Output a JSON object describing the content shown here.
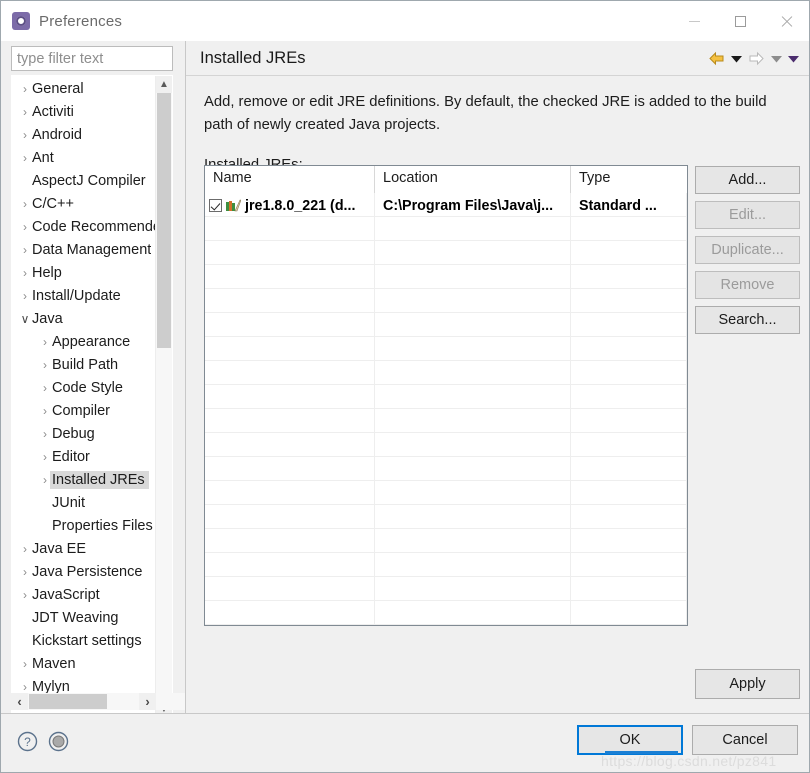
{
  "window": {
    "title": "Preferences",
    "icon": "gear-icon",
    "controls": {
      "minimize": "—",
      "maximize": "□",
      "close": "✕"
    }
  },
  "sidebar": {
    "filter": {
      "placeholder": "type filter text",
      "value": ""
    },
    "items": [
      {
        "label": "General",
        "level": 1,
        "expandable": true,
        "expanded": false,
        "selected": false
      },
      {
        "label": "Activiti",
        "level": 1,
        "expandable": true,
        "expanded": false,
        "selected": false
      },
      {
        "label": "Android",
        "level": 1,
        "expandable": true,
        "expanded": false,
        "selected": false
      },
      {
        "label": "Ant",
        "level": 1,
        "expandable": true,
        "expanded": false,
        "selected": false
      },
      {
        "label": "AspectJ Compiler",
        "level": 1,
        "expandable": false,
        "expanded": false,
        "selected": false
      },
      {
        "label": "C/C++",
        "level": 1,
        "expandable": true,
        "expanded": false,
        "selected": false
      },
      {
        "label": "Code Recommenders",
        "level": 1,
        "expandable": true,
        "expanded": false,
        "selected": false
      },
      {
        "label": "Data Management",
        "level": 1,
        "expandable": true,
        "expanded": false,
        "selected": false
      },
      {
        "label": "Help",
        "level": 1,
        "expandable": true,
        "expanded": false,
        "selected": false
      },
      {
        "label": "Install/Update",
        "level": 1,
        "expandable": true,
        "expanded": false,
        "selected": false
      },
      {
        "label": "Java",
        "level": 1,
        "expandable": true,
        "expanded": true,
        "selected": false
      },
      {
        "label": "Appearance",
        "level": 2,
        "expandable": true,
        "expanded": false,
        "selected": false
      },
      {
        "label": "Build Path",
        "level": 2,
        "expandable": true,
        "expanded": false,
        "selected": false
      },
      {
        "label": "Code Style",
        "level": 2,
        "expandable": true,
        "expanded": false,
        "selected": false
      },
      {
        "label": "Compiler",
        "level": 2,
        "expandable": true,
        "expanded": false,
        "selected": false
      },
      {
        "label": "Debug",
        "level": 2,
        "expandable": true,
        "expanded": false,
        "selected": false
      },
      {
        "label": "Editor",
        "level": 2,
        "expandable": true,
        "expanded": false,
        "selected": false
      },
      {
        "label": "Installed JREs",
        "level": 2,
        "expandable": true,
        "expanded": false,
        "selected": true
      },
      {
        "label": "JUnit",
        "level": 2,
        "expandable": false,
        "expanded": false,
        "selected": false
      },
      {
        "label": "Properties Files",
        "level": 2,
        "expandable": false,
        "expanded": false,
        "selected": false
      },
      {
        "label": "Java EE",
        "level": 1,
        "expandable": true,
        "expanded": false,
        "selected": false
      },
      {
        "label": "Java Persistence",
        "level": 1,
        "expandable": true,
        "expanded": false,
        "selected": false
      },
      {
        "label": "JavaScript",
        "level": 1,
        "expandable": true,
        "expanded": false,
        "selected": false
      },
      {
        "label": "JDT Weaving",
        "level": 1,
        "expandable": false,
        "expanded": false,
        "selected": false
      },
      {
        "label": "Kickstart settings",
        "level": 1,
        "expandable": false,
        "expanded": false,
        "selected": false
      },
      {
        "label": "Maven",
        "level": 1,
        "expandable": true,
        "expanded": false,
        "selected": false
      },
      {
        "label": "Mylyn",
        "level": 1,
        "expandable": true,
        "expanded": false,
        "selected": false
      }
    ]
  },
  "page": {
    "title": "Installed JREs",
    "description": "Add, remove or edit JRE definitions. By default, the checked JRE is added to the build path of newly created Java projects.",
    "list_label": "Installed JREs:",
    "nav": {
      "back": "back-arrow-icon",
      "back_menu": "back-dropdown-icon",
      "forward": "forward-arrow-icon",
      "forward_menu": "forward-dropdown-icon",
      "menu": "view-menu-icon"
    }
  },
  "table": {
    "columns": [
      "Name",
      "Location",
      "Type"
    ],
    "rows": [
      {
        "checked": true,
        "name": "jre1.8.0_221 (d...",
        "location": "C:\\Program Files\\Java\\j...",
        "type": "Standard ..."
      }
    ],
    "empty_row_count": 17
  },
  "side_buttons": [
    {
      "label": "Add...",
      "enabled": true
    },
    {
      "label": "Edit...",
      "enabled": false
    },
    {
      "label": "Duplicate...",
      "enabled": false
    },
    {
      "label": "Remove",
      "enabled": false
    },
    {
      "label": "Search...",
      "enabled": true
    }
  ],
  "footer": {
    "apply": "Apply",
    "ok": "OK",
    "cancel": "Cancel",
    "help_icon": "help-question-icon",
    "shell_icon": "import-export-icon",
    "watermark": "https://blog.csdn.net/pz841"
  },
  "colors": {
    "accent": "#0078d7",
    "dialog_bg": "#f0f0f0",
    "selection": "#d9d9d9",
    "back_arrow": "#e8a317"
  }
}
